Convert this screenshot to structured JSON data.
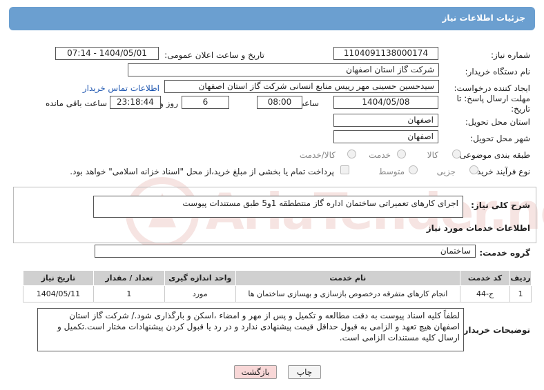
{
  "header": {
    "title": "جزئیات اطلاعات نیاز"
  },
  "form": {
    "need_number_label": "شماره نیاز:",
    "need_number": "1104091138000174",
    "announce_label": "تاریخ و ساعت اعلان عمومی:",
    "announce_value": "1404/05/01 - 07:14",
    "buyer_org_label": "نام دستگاه خریدار:",
    "buyer_org": "شرکت گاز استان اصفهان",
    "creator_label": "ایجاد کننده درخواست:",
    "creator": "سیدحسین حسینی مهر رییس منابع انسانی شرکت گاز استان اصفهان",
    "contact_link": "اطلاعات تماس خریدار",
    "deadline_label_1": "مهلت ارسال پاسخ: تا",
    "deadline_label_2": "تاریخ:",
    "deadline_date": "1404/05/08",
    "time_label": "ساعت",
    "deadline_time": "08:00",
    "days": "6",
    "days_label": "روز و",
    "remaining": "23:18:44",
    "remaining_label": "ساعت باقی مانده",
    "province_label": "استان محل تحویل:",
    "province": "اصفهان",
    "city_label": "شهر محل تحویل:",
    "city": "اصفهان",
    "category_label": "طبقه بندی موضوعی:",
    "category_options": [
      "کالا",
      "خدمت",
      "کالا/خدمت"
    ],
    "process_label": "نوع فرآیند خرید :",
    "process_options": [
      "جزیی",
      "متوسط"
    ],
    "payment_note": "پرداخت تمام یا بخشی از مبلغ خرید،از محل \"اسناد خزانه اسلامی\" خواهد بود."
  },
  "description": {
    "label": "شرح کلی نیاز:",
    "text": "اجرای کارهای تعمیراتی ساختمان اداره گاز منتططقه 1و5 طبق مستندات پیوست"
  },
  "services": {
    "section_title": "اطلاعات خدمات مورد نیاز",
    "group_label": "گروه خدمت:",
    "group_value": "ساختمان",
    "columns": [
      "ردیف",
      "کد خدمت",
      "نام خدمت",
      "واحد اندازه گیری",
      "تعداد / مقدار",
      "تاریخ نیاز"
    ],
    "rows": [
      [
        "1",
        "ج-44",
        "انجام کارهای متفرقه درخصوص بازسازی و بهسازی ساختمان ها",
        "مورد",
        "1",
        "1404/05/11"
      ]
    ]
  },
  "buyer_notes": {
    "label": "توضیحات خریدار:",
    "text": "لطفاً کلیه اسناد پیوست به دقت مطالعه و تکمیل و  پس از مهر و امضاء ،اسکن و بارگذاری شود./  شرکت گاز  استان اصفهان هیچ تعهد و الزامی به قبول حداقل قیمت پیشنهادی ندارد و در رد یا قبول کردن پیشنهادات مختار است.تکمیل و ارسال کلیه مستندات الزامی است."
  },
  "buttons": {
    "print": "چاپ",
    "back": "بازگشت"
  },
  "watermark": "AriaTender.neT",
  "colors": {
    "header_bg": "#6b9fd0",
    "link": "#1e56b0",
    "back_button": "#f8d7d7"
  }
}
